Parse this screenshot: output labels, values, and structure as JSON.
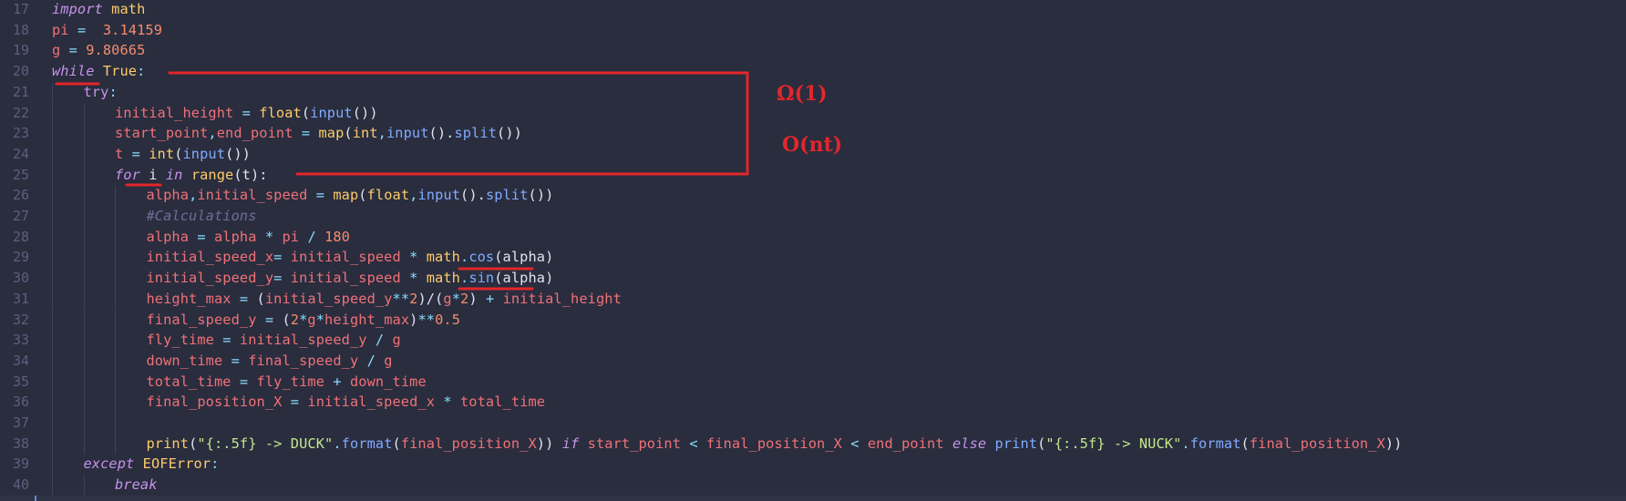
{
  "colors": {
    "background": "#292d3e",
    "keyword": "#c792ea",
    "variable": "#f07178",
    "function": "#82aaff",
    "builtin": "#ffcb6b",
    "number": "#f78c6c",
    "string": "#c3e88d",
    "operator": "#89ddff",
    "comment": "#697098",
    "annotation": "#e3262b"
  },
  "annotations": {
    "omega": "Ω(1)",
    "big_o": "O(nt)"
  },
  "lines": [
    {
      "num": "17",
      "indent": 0,
      "tokens": [
        {
          "t": "import",
          "c": "kw",
          "i": true
        },
        {
          "t": " "
        },
        {
          "t": "math",
          "c": "bi"
        }
      ]
    },
    {
      "num": "18",
      "indent": 0,
      "tokens": [
        {
          "t": "pi",
          "c": "var"
        },
        {
          "t": " "
        },
        {
          "t": "=",
          "c": "op"
        },
        {
          "t": "  "
        },
        {
          "t": "3.14159",
          "c": "num"
        }
      ]
    },
    {
      "num": "19",
      "indent": 0,
      "tokens": [
        {
          "t": "g",
          "c": "var"
        },
        {
          "t": " "
        },
        {
          "t": "=",
          "c": "op"
        },
        {
          "t": " "
        },
        {
          "t": "9.80665",
          "c": "num"
        }
      ]
    },
    {
      "num": "20",
      "indent": 0,
      "tokens": [
        {
          "t": "while",
          "c": "kw",
          "i": true
        },
        {
          "t": " "
        },
        {
          "t": "True",
          "c": "bi"
        },
        {
          "t": ":",
          "c": "op"
        }
      ]
    },
    {
      "num": "21",
      "indent": 1,
      "tokens": [
        {
          "t": "try",
          "c": "kw"
        },
        {
          "t": ":",
          "c": "op"
        }
      ]
    },
    {
      "num": "22",
      "indent": 2,
      "tokens": [
        {
          "t": "initial_height",
          "c": "var"
        },
        {
          "t": " "
        },
        {
          "t": "=",
          "c": "op"
        },
        {
          "t": " "
        },
        {
          "t": "float",
          "c": "bi"
        },
        {
          "t": "(",
          "c": "p"
        },
        {
          "t": "input",
          "c": "fn"
        },
        {
          "t": "())",
          "c": "p"
        }
      ]
    },
    {
      "num": "23",
      "indent": 2,
      "tokens": [
        {
          "t": "start_point",
          "c": "var"
        },
        {
          "t": ",",
          "c": "op"
        },
        {
          "t": "end_point",
          "c": "var"
        },
        {
          "t": " "
        },
        {
          "t": "=",
          "c": "op"
        },
        {
          "t": " "
        },
        {
          "t": "map",
          "c": "bi"
        },
        {
          "t": "(",
          "c": "p"
        },
        {
          "t": "int",
          "c": "bi"
        },
        {
          "t": ",",
          "c": "op"
        },
        {
          "t": "input",
          "c": "fn"
        },
        {
          "t": "().",
          "c": "p"
        },
        {
          "t": "split",
          "c": "fn"
        },
        {
          "t": "())",
          "c": "p"
        }
      ]
    },
    {
      "num": "24",
      "indent": 2,
      "tokens": [
        {
          "t": "t",
          "c": "var"
        },
        {
          "t": " "
        },
        {
          "t": "=",
          "c": "op"
        },
        {
          "t": " "
        },
        {
          "t": "int",
          "c": "bi"
        },
        {
          "t": "(",
          "c": "p"
        },
        {
          "t": "input",
          "c": "fn"
        },
        {
          "t": "())",
          "c": "p"
        }
      ]
    },
    {
      "num": "25",
      "indent": 2,
      "tokens": [
        {
          "t": "for",
          "c": "kw",
          "i": true
        },
        {
          "t": " "
        },
        {
          "t": "i",
          "c": "plain"
        },
        {
          "t": " "
        },
        {
          "t": "in",
          "c": "kw",
          "i": true
        },
        {
          "t": " "
        },
        {
          "t": "range",
          "c": "bi"
        },
        {
          "t": "(t):",
          "c": "plain"
        }
      ]
    },
    {
      "num": "26",
      "indent": 3,
      "tokens": [
        {
          "t": "alpha",
          "c": "var"
        },
        {
          "t": ",",
          "c": "op"
        },
        {
          "t": "initial_speed",
          "c": "var"
        },
        {
          "t": " "
        },
        {
          "t": "=",
          "c": "op"
        },
        {
          "t": " "
        },
        {
          "t": "map",
          "c": "bi"
        },
        {
          "t": "(",
          "c": "p"
        },
        {
          "t": "float",
          "c": "bi"
        },
        {
          "t": ",",
          "c": "op"
        },
        {
          "t": "input",
          "c": "fn"
        },
        {
          "t": "().",
          "c": "p"
        },
        {
          "t": "split",
          "c": "fn"
        },
        {
          "t": "())",
          "c": "p"
        }
      ]
    },
    {
      "num": "27",
      "indent": 3,
      "tokens": [
        {
          "t": "#Calculations",
          "c": "cm",
          "i": true
        }
      ]
    },
    {
      "num": "28",
      "indent": 3,
      "tokens": [
        {
          "t": "alpha",
          "c": "var"
        },
        {
          "t": " "
        },
        {
          "t": "=",
          "c": "op"
        },
        {
          "t": " "
        },
        {
          "t": "alpha",
          "c": "var"
        },
        {
          "t": " "
        },
        {
          "t": "*",
          "c": "op"
        },
        {
          "t": " "
        },
        {
          "t": "pi",
          "c": "var"
        },
        {
          "t": " "
        },
        {
          "t": "/",
          "c": "op"
        },
        {
          "t": " "
        },
        {
          "t": "180",
          "c": "num"
        }
      ]
    },
    {
      "num": "29",
      "indent": 3,
      "tokens": [
        {
          "t": "initial_speed_x",
          "c": "var"
        },
        {
          "t": "=",
          "c": "op"
        },
        {
          "t": " "
        },
        {
          "t": "initial_speed",
          "c": "var"
        },
        {
          "t": " "
        },
        {
          "t": "*",
          "c": "op"
        },
        {
          "t": " "
        },
        {
          "t": "math",
          "c": "bi"
        },
        {
          "t": ".",
          "c": "op"
        },
        {
          "t": "cos",
          "c": "fn"
        },
        {
          "t": "(alpha)",
          "c": "plain"
        }
      ]
    },
    {
      "num": "30",
      "indent": 3,
      "tokens": [
        {
          "t": "initial_speed_y",
          "c": "var"
        },
        {
          "t": "=",
          "c": "op"
        },
        {
          "t": " "
        },
        {
          "t": "initial_speed",
          "c": "var"
        },
        {
          "t": " "
        },
        {
          "t": "*",
          "c": "op"
        },
        {
          "t": " "
        },
        {
          "t": "math",
          "c": "bi"
        },
        {
          "t": ".",
          "c": "op"
        },
        {
          "t": "sin",
          "c": "fn"
        },
        {
          "t": "(alpha)",
          "c": "plain"
        }
      ]
    },
    {
      "num": "31",
      "indent": 3,
      "tokens": [
        {
          "t": "height_max",
          "c": "var"
        },
        {
          "t": " "
        },
        {
          "t": "=",
          "c": "op"
        },
        {
          "t": " "
        },
        {
          "t": "(",
          "c": "p"
        },
        {
          "t": "initial_speed_y",
          "c": "var"
        },
        {
          "t": "**",
          "c": "op"
        },
        {
          "t": "2",
          "c": "num"
        },
        {
          "t": ")/(",
          "c": "p"
        },
        {
          "t": "g",
          "c": "var"
        },
        {
          "t": "*",
          "c": "op"
        },
        {
          "t": "2",
          "c": "num"
        },
        {
          "t": ")",
          "c": "p"
        },
        {
          "t": " "
        },
        {
          "t": "+",
          "c": "op"
        },
        {
          "t": " "
        },
        {
          "t": "initial_height",
          "c": "var"
        }
      ]
    },
    {
      "num": "32",
      "indent": 3,
      "tokens": [
        {
          "t": "final_speed_y",
          "c": "var"
        },
        {
          "t": " "
        },
        {
          "t": "=",
          "c": "op"
        },
        {
          "t": " "
        },
        {
          "t": "(",
          "c": "p"
        },
        {
          "t": "2",
          "c": "num"
        },
        {
          "t": "*",
          "c": "op"
        },
        {
          "t": "g",
          "c": "var"
        },
        {
          "t": "*",
          "c": "op"
        },
        {
          "t": "height_max",
          "c": "var"
        },
        {
          "t": ")",
          "c": "p"
        },
        {
          "t": "**",
          "c": "op"
        },
        {
          "t": "0.5",
          "c": "num"
        }
      ]
    },
    {
      "num": "33",
      "indent": 3,
      "tokens": [
        {
          "t": "fly_time",
          "c": "var"
        },
        {
          "t": " "
        },
        {
          "t": "=",
          "c": "op"
        },
        {
          "t": " "
        },
        {
          "t": "initial_speed_y",
          "c": "var"
        },
        {
          "t": " "
        },
        {
          "t": "/",
          "c": "op"
        },
        {
          "t": " "
        },
        {
          "t": "g",
          "c": "var"
        }
      ]
    },
    {
      "num": "34",
      "indent": 3,
      "tokens": [
        {
          "t": "down_time",
          "c": "var"
        },
        {
          "t": " "
        },
        {
          "t": "=",
          "c": "op"
        },
        {
          "t": " "
        },
        {
          "t": "final_speed_y",
          "c": "var"
        },
        {
          "t": " "
        },
        {
          "t": "/",
          "c": "op"
        },
        {
          "t": " "
        },
        {
          "t": "g",
          "c": "var"
        }
      ]
    },
    {
      "num": "35",
      "indent": 3,
      "tokens": [
        {
          "t": "total_time",
          "c": "var"
        },
        {
          "t": " "
        },
        {
          "t": "=",
          "c": "op"
        },
        {
          "t": " "
        },
        {
          "t": "fly_time",
          "c": "var"
        },
        {
          "t": " "
        },
        {
          "t": "+",
          "c": "op"
        },
        {
          "t": " "
        },
        {
          "t": "down_time",
          "c": "var"
        }
      ]
    },
    {
      "num": "36",
      "indent": 3,
      "tokens": [
        {
          "t": "final_position_X",
          "c": "var"
        },
        {
          "t": " "
        },
        {
          "t": "=",
          "c": "op"
        },
        {
          "t": " "
        },
        {
          "t": "initial_speed_x",
          "c": "var"
        },
        {
          "t": " "
        },
        {
          "t": "*",
          "c": "op"
        },
        {
          "t": " "
        },
        {
          "t": "total_time",
          "c": "var"
        }
      ]
    },
    {
      "num": "37",
      "indent": 3,
      "tokens": []
    },
    {
      "num": "38",
      "indent": 3,
      "tokens": [
        {
          "t": "print",
          "c": "bi"
        },
        {
          "t": "(",
          "c": "p"
        },
        {
          "t": "\"{:.5f} -> DUCK\"",
          "c": "str"
        },
        {
          "t": ".",
          "c": "op"
        },
        {
          "t": "format",
          "c": "fn"
        },
        {
          "t": "(",
          "c": "p"
        },
        {
          "t": "final_position_X",
          "c": "var"
        },
        {
          "t": "))",
          "c": "p"
        },
        {
          "t": " "
        },
        {
          "t": "if",
          "c": "kw",
          "i": true
        },
        {
          "t": " "
        },
        {
          "t": "start_point",
          "c": "var"
        },
        {
          "t": " "
        },
        {
          "t": "<",
          "c": "op"
        },
        {
          "t": " "
        },
        {
          "t": "final_position_X",
          "c": "var"
        },
        {
          "t": " "
        },
        {
          "t": "<",
          "c": "op"
        },
        {
          "t": " "
        },
        {
          "t": "end_point",
          "c": "var"
        },
        {
          "t": " "
        },
        {
          "t": "else",
          "c": "kw",
          "i": true
        },
        {
          "t": " "
        },
        {
          "t": "print",
          "c": "fn"
        },
        {
          "t": "(",
          "c": "p"
        },
        {
          "t": "\"{:.5f} -> NUCK\"",
          "c": "str"
        },
        {
          "t": ".",
          "c": "op"
        },
        {
          "t": "format",
          "c": "fn"
        },
        {
          "t": "(",
          "c": "p"
        },
        {
          "t": "final_position_X",
          "c": "var"
        },
        {
          "t": "))",
          "c": "p"
        }
      ]
    },
    {
      "num": "39",
      "indent": 1,
      "tokens": [
        {
          "t": "except",
          "c": "kw",
          "i": true
        },
        {
          "t": " "
        },
        {
          "t": "EOFError",
          "c": "bi"
        },
        {
          "t": ":",
          "c": "op"
        }
      ]
    },
    {
      "num": "40",
      "indent": 2,
      "tokens": [
        {
          "t": "break",
          "c": "kw",
          "i": true
        }
      ]
    }
  ]
}
